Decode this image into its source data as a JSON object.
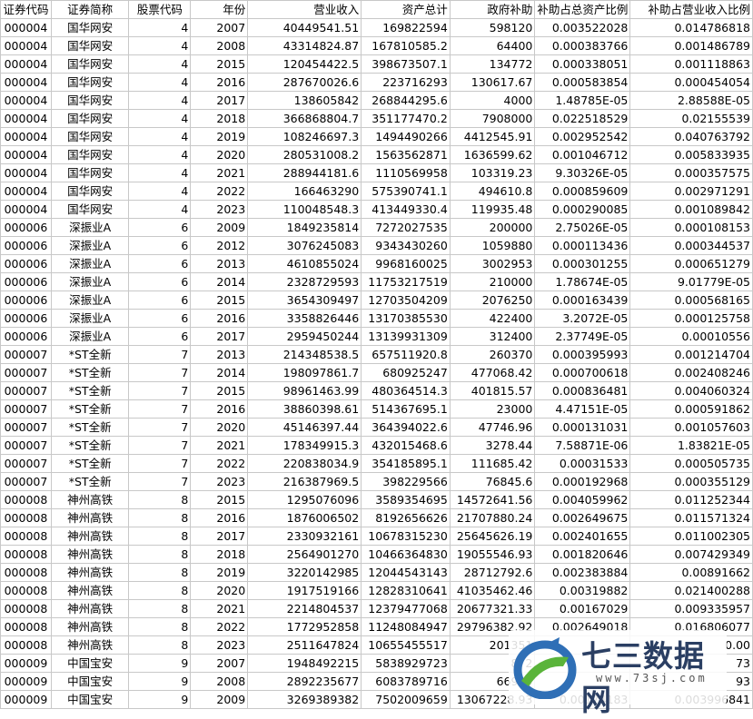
{
  "headers": [
    "证券代码",
    "证券简称",
    "股票代码",
    "年份",
    "营业收入",
    "资产总计",
    "政府补助",
    "补助占总资产比例",
    "补助占营业收入比例"
  ],
  "rows": [
    [
      "000004",
      "国华网安",
      "4",
      "2007",
      "40449541.51",
      "169822594",
      "598120",
      "0.003522028",
      "0.014786818"
    ],
    [
      "000004",
      "国华网安",
      "4",
      "2008",
      "43314824.87",
      "167810585.2",
      "64400",
      "0.000383766",
      "0.001486789"
    ],
    [
      "000004",
      "国华网安",
      "4",
      "2015",
      "120454422.5",
      "398673507.1",
      "134772",
      "0.000338051",
      "0.001118863"
    ],
    [
      "000004",
      "国华网安",
      "4",
      "2016",
      "287670026.6",
      "223716293",
      "130617.67",
      "0.000583854",
      "0.000454054"
    ],
    [
      "000004",
      "国华网安",
      "4",
      "2017",
      "138605842",
      "268844295.6",
      "4000",
      "1.48785E-05",
      "2.88588E-05"
    ],
    [
      "000004",
      "国华网安",
      "4",
      "2018",
      "366868804.7",
      "351177470.2",
      "7908000",
      "0.022518529",
      "0.02155539"
    ],
    [
      "000004",
      "国华网安",
      "4",
      "2019",
      "108246697.3",
      "1494490266",
      "4412545.91",
      "0.002952542",
      "0.040763792"
    ],
    [
      "000004",
      "国华网安",
      "4",
      "2020",
      "280531008.2",
      "1563562871",
      "1636599.62",
      "0.001046712",
      "0.005833935"
    ],
    [
      "000004",
      "国华网安",
      "4",
      "2021",
      "288944181.6",
      "1110569958",
      "103319.23",
      "9.30326E-05",
      "0.000357575"
    ],
    [
      "000004",
      "国华网安",
      "4",
      "2022",
      "166463290",
      "575390741.1",
      "494610.8",
      "0.000859609",
      "0.002971291"
    ],
    [
      "000004",
      "国华网安",
      "4",
      "2023",
      "110048548.3",
      "413449330.4",
      "119935.48",
      "0.000290085",
      "0.001089842"
    ],
    [
      "000006",
      "深振业A",
      "6",
      "2009",
      "1849235814",
      "7272027535",
      "200000",
      "2.75026E-05",
      "0.000108153"
    ],
    [
      "000006",
      "深振业A",
      "6",
      "2012",
      "3076245083",
      "9343430260",
      "1059880",
      "0.000113436",
      "0.000344537"
    ],
    [
      "000006",
      "深振业A",
      "6",
      "2013",
      "4610855024",
      "9968160025",
      "3002953",
      "0.000301255",
      "0.000651279"
    ],
    [
      "000006",
      "深振业A",
      "6",
      "2014",
      "2328729593",
      "11753217519",
      "210000",
      "1.78674E-05",
      "9.01779E-05"
    ],
    [
      "000006",
      "深振业A",
      "6",
      "2015",
      "3654309497",
      "12703504209",
      "2076250",
      "0.000163439",
      "0.000568165"
    ],
    [
      "000006",
      "深振业A",
      "6",
      "2016",
      "3358826446",
      "13170385530",
      "422400",
      "3.2072E-05",
      "0.000125758"
    ],
    [
      "000006",
      "深振业A",
      "6",
      "2017",
      "2959450244",
      "13139931309",
      "312400",
      "2.37749E-05",
      "0.00010556"
    ],
    [
      "000007",
      "*ST全新",
      "7",
      "2013",
      "214348538.5",
      "657511920.8",
      "260370",
      "0.000395993",
      "0.001214704"
    ],
    [
      "000007",
      "*ST全新",
      "7",
      "2014",
      "198097861.7",
      "680925247",
      "477068.42",
      "0.000700618",
      "0.002408246"
    ],
    [
      "000007",
      "*ST全新",
      "7",
      "2015",
      "98961463.99",
      "480364514.3",
      "401815.57",
      "0.000836481",
      "0.004060324"
    ],
    [
      "000007",
      "*ST全新",
      "7",
      "2016",
      "38860398.61",
      "514367695.1",
      "23000",
      "4.47151E-05",
      "0.000591862"
    ],
    [
      "000007",
      "*ST全新",
      "7",
      "2020",
      "45146397.44",
      "364394022.6",
      "47746.96",
      "0.000131031",
      "0.001057603"
    ],
    [
      "000007",
      "*ST全新",
      "7",
      "2021",
      "178349915.3",
      "432015468.6",
      "3278.44",
      "7.58871E-06",
      "1.83821E-05"
    ],
    [
      "000007",
      "*ST全新",
      "7",
      "2022",
      "220838034.9",
      "354185895.1",
      "111685.42",
      "0.00031533",
      "0.000505735"
    ],
    [
      "000007",
      "*ST全新",
      "7",
      "2023",
      "216387969.5",
      "398229566",
      "76845.6",
      "0.000192968",
      "0.000355129"
    ],
    [
      "000008",
      "神州高铁",
      "8",
      "2015",
      "1295076096",
      "3589354695",
      "14572641.56",
      "0.004059962",
      "0.011252344"
    ],
    [
      "000008",
      "神州高铁",
      "8",
      "2016",
      "1876006502",
      "8192656626",
      "21707880.24",
      "0.002649675",
      "0.011571324"
    ],
    [
      "000008",
      "神州高铁",
      "8",
      "2017",
      "2330932161",
      "10678315230",
      "25645626.19",
      "0.002401655",
      "0.011002305"
    ],
    [
      "000008",
      "神州高铁",
      "8",
      "2018",
      "2564901270",
      "10466364830",
      "19055546.93",
      "0.001820646",
      "0.007429349"
    ],
    [
      "000008",
      "神州高铁",
      "8",
      "2019",
      "3220142985",
      "12044543143",
      "28712792.6",
      "0.002383884",
      "0.00891662"
    ],
    [
      "000008",
      "神州高铁",
      "8",
      "2020",
      "1917519166",
      "12828310641",
      "41035462.46",
      "0.0031988​2",
      "0.021400288"
    ],
    [
      "000008",
      "神州高铁",
      "8",
      "2021",
      "2214804537",
      "12379477068",
      "20677321.33",
      "0.00167029",
      "0.009335957"
    ],
    [
      "000008",
      "神州高铁",
      "8",
      "2022",
      "1772952858",
      "11248084947",
      "29796382.92",
      "0.002649018",
      "0.016806077"
    ],
    [
      "000008",
      "神州高铁",
      "8",
      "2023",
      "2511647824",
      "10655455517",
      "201351",
      "",
      "0.00"
    ],
    [
      "000009",
      "中国宝安",
      "9",
      "2007",
      "1948492215",
      "5838929723",
      "872",
      "",
      "73"
    ],
    [
      "000009",
      "中国宝安",
      "9",
      "2008",
      "2892235677",
      "6083789716",
      "66910",
      "",
      "93"
    ],
    [
      "000009",
      "中国宝安",
      "9",
      "2009",
      "3269389382",
      "7502009659",
      "13067228.93",
      "0.00174183",
      "0.003996841"
    ]
  ],
  "watermark": {
    "title": "七三数据网",
    "url": "www.73sj.com"
  },
  "colors": {
    "grid": "#c8c8c8",
    "logo_blue": "#2f6fb6",
    "logo_green": "#5ab43a",
    "logo_text": "#2b3f63"
  }
}
